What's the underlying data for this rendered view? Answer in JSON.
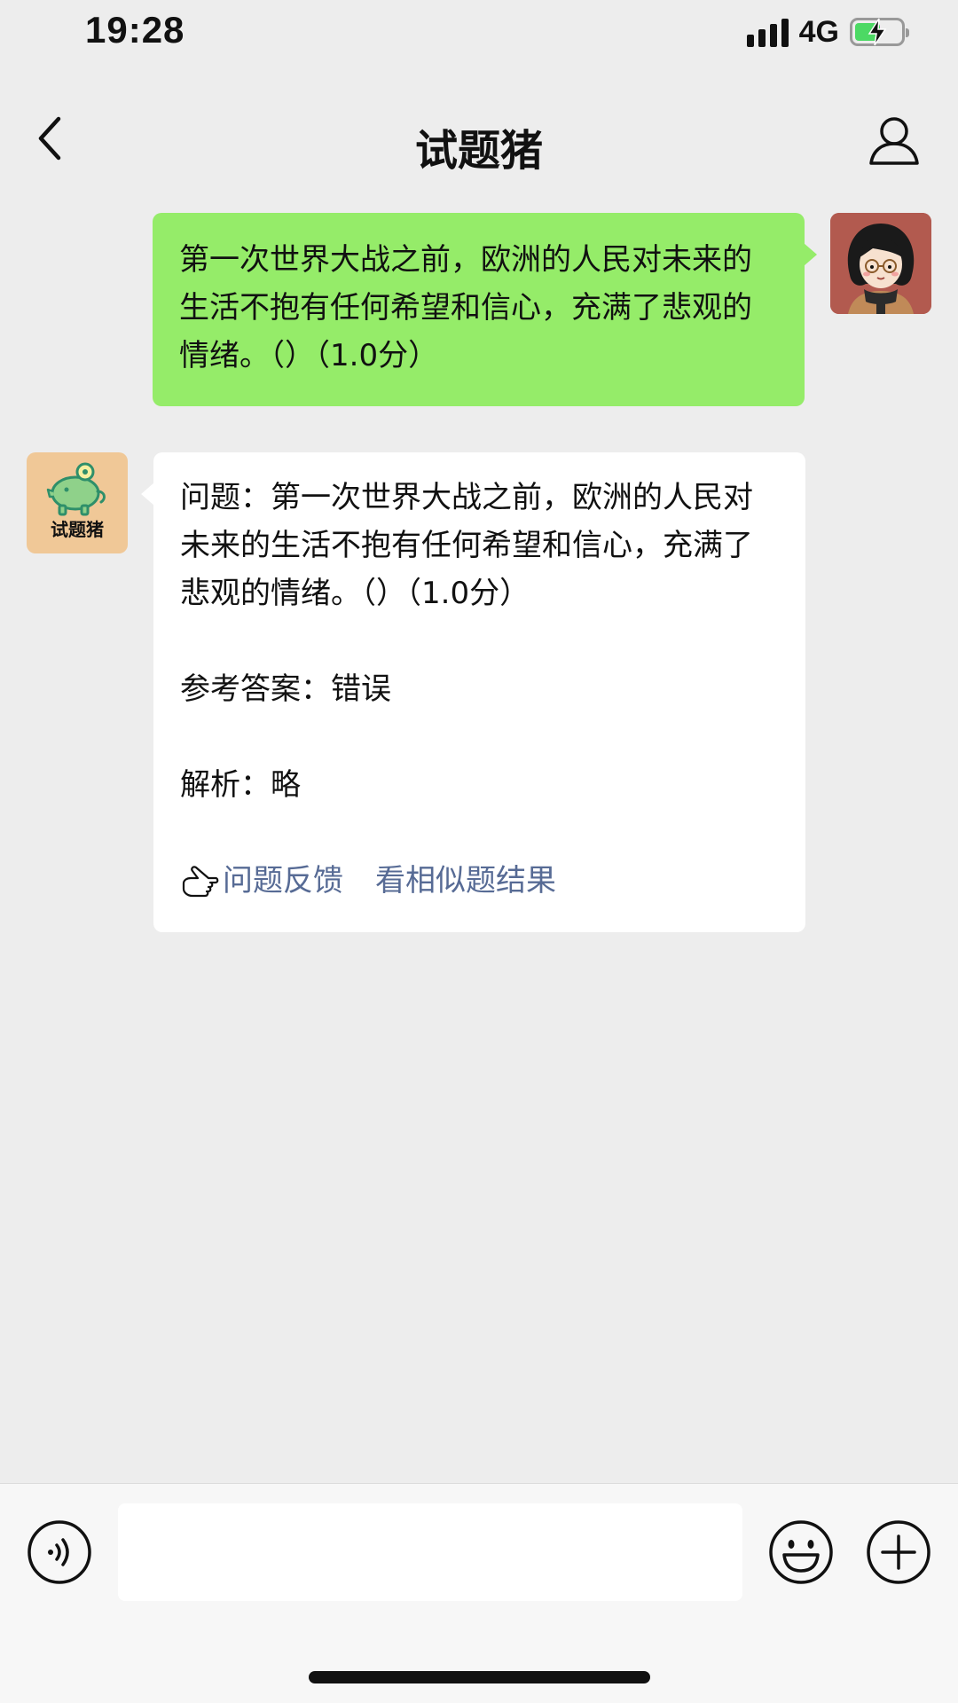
{
  "status_bar": {
    "time": "19:28",
    "network": "4G",
    "signal_icon": "signal-bars-icon",
    "battery_icon": "battery-charging-icon"
  },
  "nav": {
    "title": "试题猪",
    "back_icon": "chevron-left-icon",
    "profile_icon": "person-icon"
  },
  "messages": {
    "user_question": {
      "text": "第一次世界大战之前，欧洲的人民对未来的生活不抱有任何希望和信心，充满了悲观的情绪。（）（1.0分）"
    },
    "bot_answer": {
      "avatar_label": "试题猪",
      "question": "问题：第一次世界大战之前，欧洲的人民对未来的生活不抱有任何希望和信心，充满了悲观的情绪。（）（1.0分）",
      "answer": "参考答案：错误",
      "analysis": "解析：略",
      "feedback_link": "问题反馈",
      "similar_link": "看相似题结果"
    }
  },
  "input_bar": {
    "voice_icon": "voice-icon",
    "emoji_icon": "smiley-icon",
    "plus_icon": "plus-circle-icon",
    "placeholder": ""
  },
  "colors": {
    "background": "#ededed",
    "user_bubble": "#95ec69",
    "bot_bubble": "#ffffff",
    "link": "#576b95",
    "bot_avatar_bg": "#f0c897",
    "user_avatar_bg": "#b25a4f"
  }
}
